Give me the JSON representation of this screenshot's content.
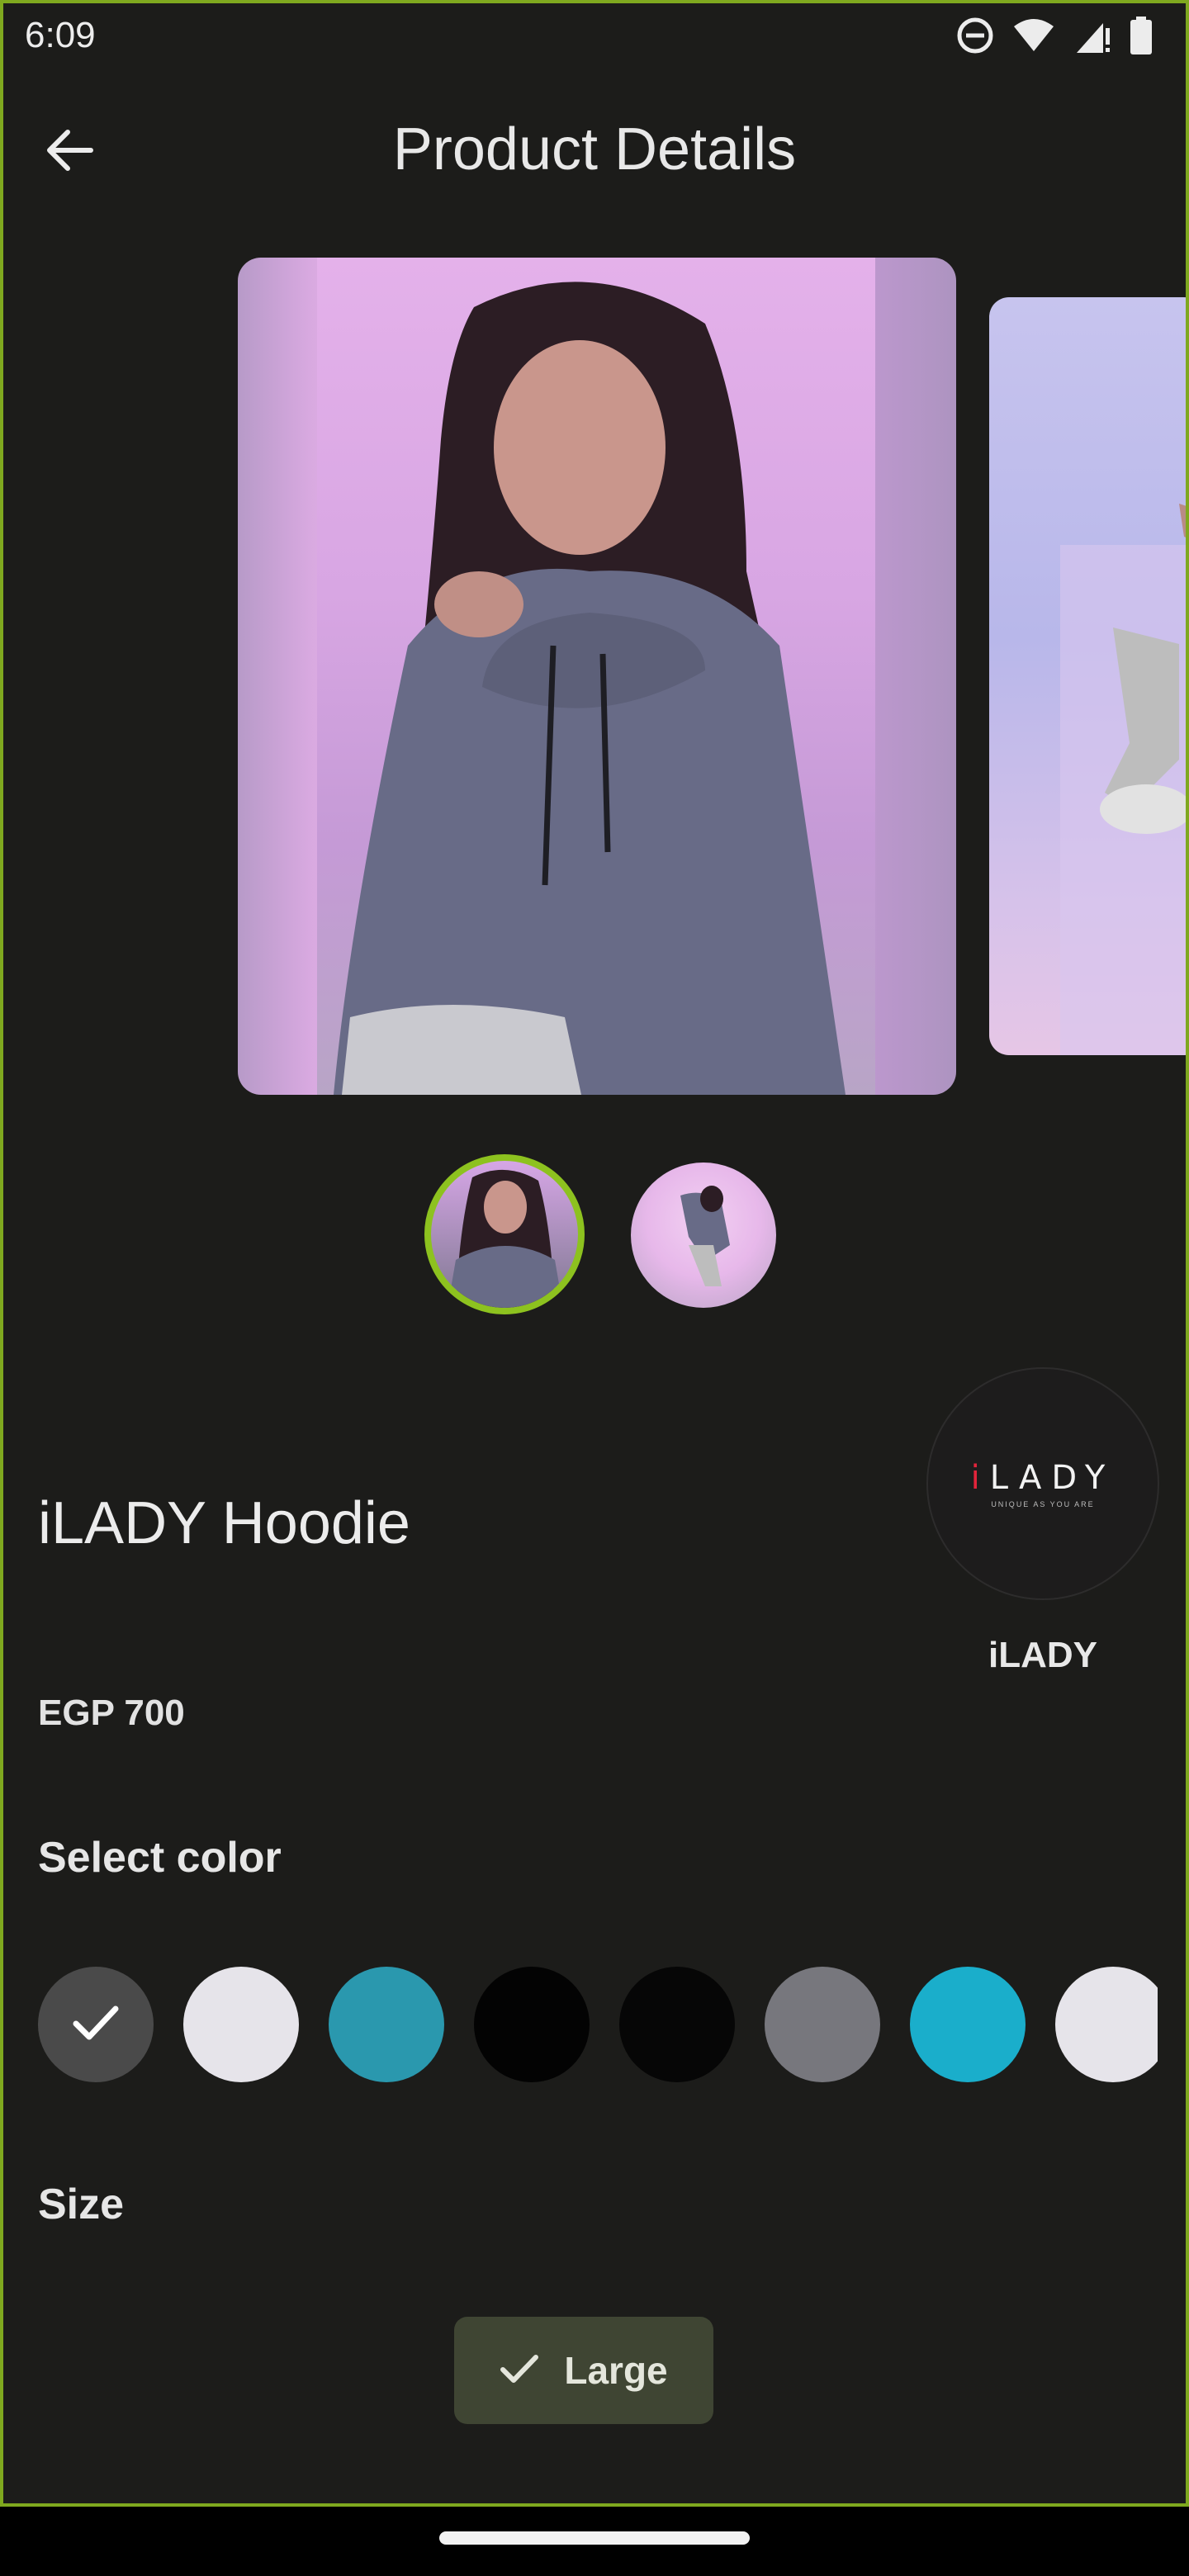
{
  "status_bar": {
    "time": "6:09",
    "icons": [
      "do-not-disturb-icon",
      "wifi-icon",
      "signal-icon",
      "battery-icon"
    ]
  },
  "header": {
    "title": "Product Details",
    "back_icon": "arrow-left-icon"
  },
  "gallery": {
    "images": [
      {
        "description_icon": "product-photo-hoodie-front"
      },
      {
        "description_icon": "product-photo-hoodie-pose"
      }
    ],
    "selected_index": 0,
    "accent_color": "#8dc21f"
  },
  "product": {
    "name": "iLADY Hoodie",
    "price": "EGP 700"
  },
  "brand": {
    "logo_text": "LADY",
    "logo_i": "i",
    "logo_tagline": "UNIQUE AS YOU ARE",
    "name": "iLADY"
  },
  "color_section": {
    "label": "Select color",
    "swatches": [
      "#4a4a4a",
      "#e6e4ea",
      "#2a98ae",
      "#030303",
      "#060606",
      "#77777d",
      "#1aaecb",
      "#e6e4ea"
    ],
    "selected_index": 0
  },
  "size_section": {
    "label": "Size",
    "selected": "Large"
  }
}
